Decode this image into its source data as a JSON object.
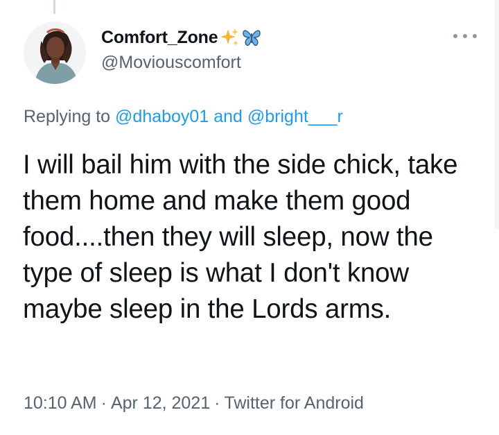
{
  "tweet": {
    "display_name": "Comfort_Zone",
    "name_emojis": [
      "sparkles-emoji",
      "butterfly-emoji"
    ],
    "handle": "@Moviouscomfort",
    "replying_prefix": "Replying to",
    "replying_to": [
      "@dhaboy01",
      "@bright___r"
    ],
    "replying_joiner": "and",
    "text": "I will bail him with the side chick, take them home and make them good food....then they will sleep, now the type of sleep is what I don't know maybe sleep in the Lords arms.",
    "time": "10:10 AM",
    "date": "Apr 12, 2021",
    "source": "Twitter for Android",
    "separator": "·"
  },
  "icons": {
    "more": "more-horizontal-icon"
  },
  "colors": {
    "text_primary": "#0f1419",
    "text_secondary": "#536471",
    "link": "#1d9bf0",
    "background": "#ffffff"
  }
}
